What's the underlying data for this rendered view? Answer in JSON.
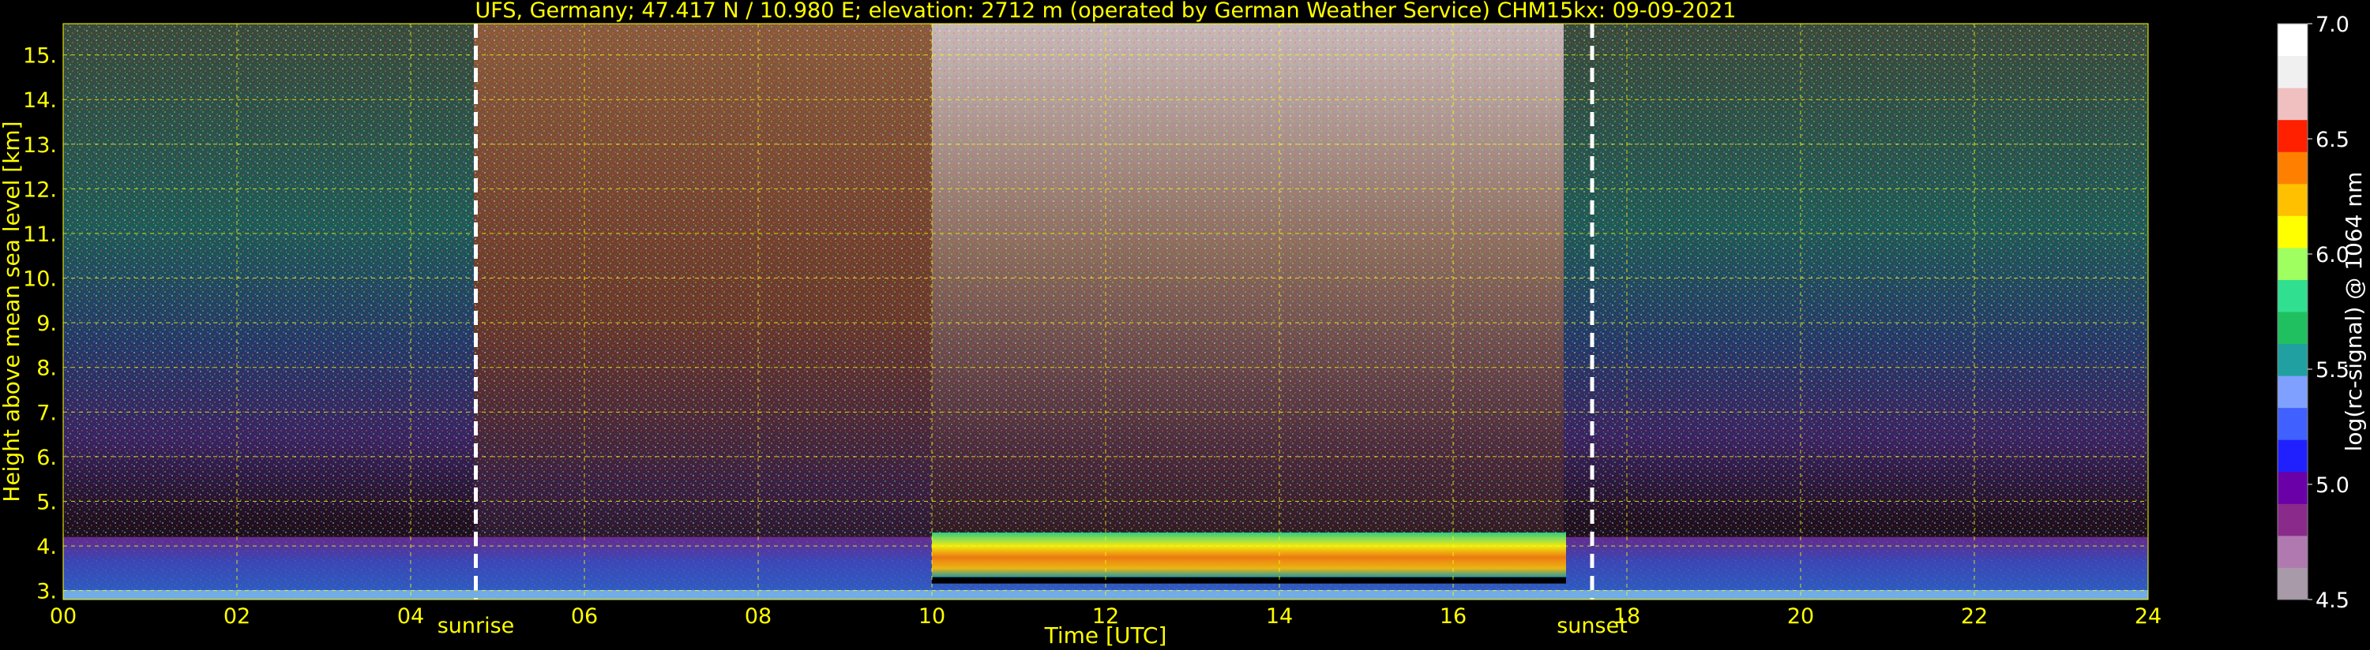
{
  "chart_data": {
    "type": "heatmap",
    "title": "UFS, Germany; 47.417 N / 10.980 E; elevation: 2712 m  (operated by German Weather Service)    CHM15kx: 09-09-2021",
    "xlabel": "Time [UTC]",
    "ylabel": "Height above mean sea level [km]",
    "xlim": [
      0,
      24
    ],
    "ylim": [
      2.8,
      15.7
    ],
    "x_ticks": [
      "00",
      "02",
      "04",
      "06",
      "08",
      "10",
      "12",
      "14",
      "16",
      "18",
      "20",
      "22",
      "24"
    ],
    "y_ticks": [
      "3.",
      "4.",
      "5.",
      "6.",
      "7.",
      "8.",
      "9.",
      "10.",
      "11.",
      "12.",
      "13.",
      "14.",
      "15."
    ],
    "grid": true,
    "annotations": [
      {
        "label": "sunrise",
        "x": 4.75
      },
      {
        "label": "sunset",
        "x": 17.6
      }
    ],
    "colorbar": {
      "label": "log(rc-signal) @ 1064 nm",
      "range": [
        4.5,
        7.0
      ],
      "ticks": [
        "4.5",
        "5.0",
        "5.5",
        "6.0",
        "6.5",
        "7.0"
      ]
    },
    "layers": [
      {
        "name": "boundary layer",
        "x_range": [
          0,
          24
        ],
        "top_km": 4.2
      },
      {
        "name": "cloud layer",
        "x_range": [
          10,
          17.3
        ],
        "base_km": 3.3,
        "top_km": 4.3
      }
    ]
  },
  "colors": {
    "accent": "#ffff00",
    "grid": "#ffff00",
    "colormap": [
      "#a89aa8",
      "#b07ab0",
      "#8a2a8a",
      "#6a00a8",
      "#2020ff",
      "#4060ff",
      "#80a0ff",
      "#20a0a0",
      "#20c060",
      "#30e090",
      "#a0ff60",
      "#ffff00",
      "#ffc000",
      "#ff8000",
      "#ff2000",
      "#f0c0c0",
      "#f0f0f0",
      "#ffffff"
    ]
  }
}
